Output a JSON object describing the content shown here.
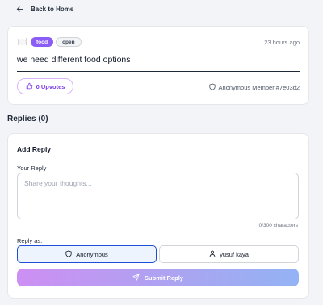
{
  "nav": {
    "back_label": "Back to Home"
  },
  "post": {
    "emoji": "🍽️",
    "category": "food",
    "status": "open",
    "time": "23 hours ago",
    "title": "we need different food options",
    "upvote_label": "0 Upvotes",
    "author": "Anonymous Member #7e03d2"
  },
  "replies": {
    "heading": "Replies (0)"
  },
  "reply_form": {
    "title": "Add Reply",
    "your_reply_label": "Your Reply",
    "placeholder": "Share your thoughts...",
    "char_count": "0/300 characters",
    "reply_as_label": "Reply as:",
    "options": [
      {
        "label": "Anonymous",
        "icon": "shield-icon",
        "selected": true
      },
      {
        "label": "yusuf kaya",
        "icon": "user-icon",
        "selected": false
      }
    ],
    "submit_label": "Submit Reply"
  },
  "colors": {
    "accent": "#8b5cf6",
    "selected_border": "#1d4ed8",
    "submit_gradient_start": "#cd8ff3",
    "submit_gradient_end": "#93b3f4"
  }
}
